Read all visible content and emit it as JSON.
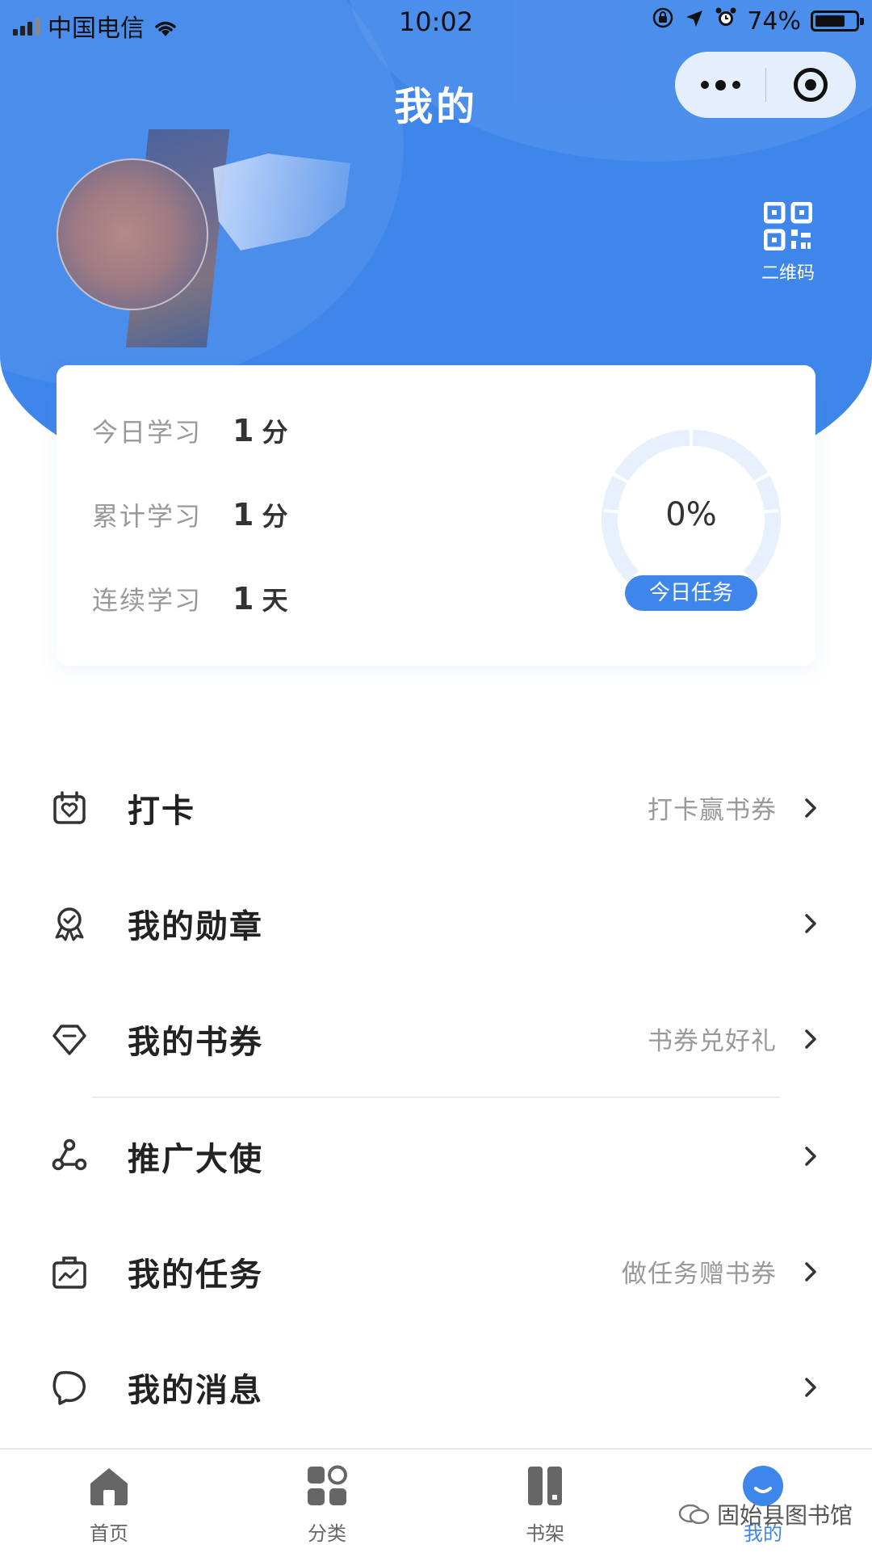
{
  "status_bar": {
    "carrier": "中国电信",
    "time": "10:02",
    "battery_percent": "74%",
    "battery_level": 0.74
  },
  "header": {
    "title": "我的",
    "qr_label": "二维码"
  },
  "stats": {
    "today": {
      "label": "今日学习",
      "value": "1",
      "unit": "分"
    },
    "total": {
      "label": "累计学习",
      "value": "1",
      "unit": "分"
    },
    "streak": {
      "label": "连续学习",
      "value": "1",
      "unit": "天"
    },
    "task_percent": "0%",
    "task_progress": 0,
    "task_label": "今日任务"
  },
  "menu": [
    {
      "icon": "calendar-heart-icon",
      "title": "打卡",
      "hint": "打卡赢书券"
    },
    {
      "icon": "medal-icon",
      "title": "我的勋章",
      "hint": ""
    },
    {
      "icon": "coupon-diamond-icon",
      "title": "我的书券",
      "hint": "书券兑好礼"
    },
    {
      "icon": "share-nodes-icon",
      "title": "推广大使",
      "hint": ""
    },
    {
      "icon": "task-briefcase-icon",
      "title": "我的任务",
      "hint": "做任务赠书券"
    },
    {
      "icon": "message-bubble-icon",
      "title": "我的消息",
      "hint": ""
    }
  ],
  "tabbar": {
    "tabs": [
      {
        "label": "首页",
        "icon": "home-icon"
      },
      {
        "label": "分类",
        "icon": "grid-icon"
      },
      {
        "label": "书架",
        "icon": "bookshelf-icon"
      },
      {
        "label": "我的",
        "icon": "profile-icon",
        "active": true
      }
    ]
  },
  "watermark": "固始县图书馆",
  "colors": {
    "primary": "#3f86ea",
    "muted_text": "#999999",
    "ring_track": "#e8f0fd"
  }
}
